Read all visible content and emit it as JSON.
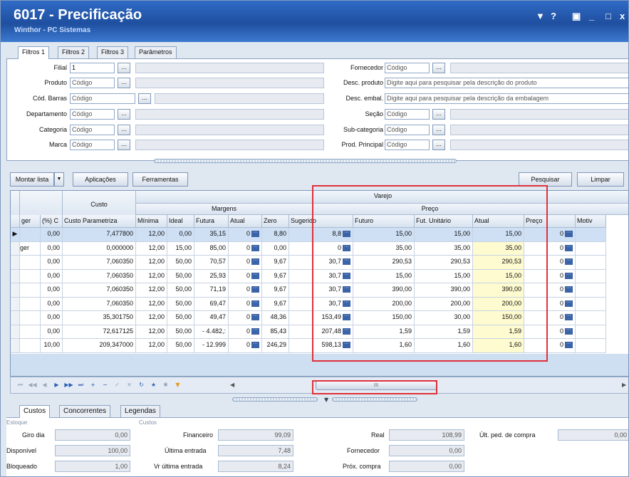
{
  "window": {
    "title": "6017 - Precificação",
    "subtitle": "Winthor - PC Sistemas",
    "controls": [
      "▼",
      "?",
      "▣",
      "_",
      "□",
      "x"
    ]
  },
  "top_tabs": [
    "Filtros 1",
    "Filtros 2",
    "Filtros 3",
    "Parâmetros"
  ],
  "filters": {
    "filial": {
      "label": "Filial",
      "value": "1"
    },
    "produto": {
      "label": "Produto",
      "placeholder": "Código"
    },
    "cod_barras": {
      "label": "Cód. Barras",
      "placeholder": "Código"
    },
    "departamento": {
      "label": "Departamento",
      "placeholder": "Código"
    },
    "categoria": {
      "label": "Categoria",
      "placeholder": "Código"
    },
    "marca": {
      "label": "Marca",
      "placeholder": "Código"
    },
    "fornecedor": {
      "label": "Fornecedor",
      "placeholder": "Código"
    },
    "desc_produto": {
      "label": "Desc. produto",
      "placeholder": "Digite aqui para pesquisar pela descrição do produto"
    },
    "desc_embal": {
      "label": "Desc. embal.",
      "placeholder": "Digite aqui para pesquisar pela descrição da embalagem"
    },
    "secao": {
      "label": "Seção",
      "placeholder": "Código"
    },
    "subcategoria": {
      "label": "Sub-categoria",
      "placeholder": "Código"
    },
    "prod_principal": {
      "label": "Prod. Principal",
      "placeholder": "Código"
    },
    "lookup_label": "..."
  },
  "toolbar": {
    "montar_lista": "Montar lista",
    "aplicacoes": "Aplicações",
    "ferramentas": "Ferramentas",
    "pesquisar": "Pesquisar",
    "limpar": "Limpar"
  },
  "grid": {
    "group_varejo": "Varejo",
    "group_custo": "Custo",
    "group_margens": "Margens",
    "group_preco": "Preço",
    "columns": [
      "ger",
      "(%) C",
      "Custo Parametriza",
      "Mínima",
      "Ideal",
      "Futura",
      "Atual",
      "Zero",
      "Sugerido",
      "Futuro",
      "Fut. Unitário",
      "Atual",
      "Preço",
      "Motiv"
    ],
    "rows": [
      [
        "",
        "0,00",
        "7,477800",
        "12,00",
        "0,00",
        "35,15",
        "0",
        "8,80",
        "8,8",
        "15,00",
        "15,00",
        "15,00",
        "0",
        ""
      ],
      [
        "ger",
        "0,00",
        "0,000000",
        "12,00",
        "15,00",
        "85,00",
        "0",
        "0,00",
        "0",
        "35,00",
        "35,00",
        "35,00",
        "0",
        ""
      ],
      [
        "",
        "0,00",
        "7,060350",
        "12,00",
        "50,00",
        "70,57",
        "0",
        "9,67",
        "30,7",
        "290,53",
        "290,53",
        "290,53",
        "0",
        ""
      ],
      [
        "",
        "0,00",
        "7,060350",
        "12,00",
        "50,00",
        "25,93",
        "0",
        "9,67",
        "30,7",
        "15,00",
        "15,00",
        "15,00",
        "0",
        ""
      ],
      [
        "",
        "0,00",
        "7,060350",
        "12,00",
        "50,00",
        "71,19",
        "0",
        "9,67",
        "30,7",
        "390,00",
        "390,00",
        "390,00",
        "0",
        ""
      ],
      [
        "",
        "0,00",
        "7,060350",
        "12,00",
        "50,00",
        "69,47",
        "0",
        "9,67",
        "30,7",
        "200,00",
        "200,00",
        "200,00",
        "0",
        ""
      ],
      [
        "",
        "0,00",
        "35,301750",
        "12,00",
        "50,00",
        "49,47",
        "0",
        "48,36",
        "153,49",
        "150,00",
        "30,00",
        "150,00",
        "0",
        ""
      ],
      [
        "",
        "0,00",
        "72,617125",
        "12,00",
        "50,00",
        "- 4.482,:",
        "0",
        "85,43",
        "207,48",
        "1,59",
        "1,59",
        "1,59",
        "0",
        ""
      ],
      [
        "",
        "10,00",
        "209,347000",
        "12,00",
        "50,00",
        "- 12.999",
        "0",
        "246,29",
        "598,13",
        "1,60",
        "1,60",
        "1,60",
        "0",
        ""
      ]
    ],
    "ellipsis": "···",
    "current_row_marker": "▶"
  },
  "navbar": {
    "buttons": [
      "⏮",
      "◀◀",
      "◀",
      "▶",
      "▶▶",
      "⏭",
      "+",
      "−",
      "✓",
      "✕",
      "↻",
      "★",
      "✱",
      "▼"
    ],
    "scroll_thumb": "III"
  },
  "bottom_tabs": [
    "Custos",
    "Concorrentes",
    "Legendas"
  ],
  "bottom": {
    "legend_estoque": "Estoque",
    "legend_custos": "Custos",
    "giro_dia": {
      "label": "Giro dia",
      "value": "0,00"
    },
    "disponivel": {
      "label": "Disponível",
      "value": "100,00"
    },
    "bloqueado": {
      "label": "Bloqueado",
      "value": "1,00"
    },
    "financeiro": {
      "label": "Financeiro",
      "value": "99,09"
    },
    "ultima_entrada": {
      "label": "Última entrada",
      "value": "7,48"
    },
    "vr_ultima_entrada": {
      "label": "Vr última entrada",
      "value": "8,24"
    },
    "real": {
      "label": "Real",
      "value": "108,99"
    },
    "fornecedor": {
      "label": "Fornecedor",
      "value": "0,00"
    },
    "prox_compra": {
      "label": "Próx. compra",
      "value": "0,00"
    },
    "ult_ped_compra": {
      "label": "Últ. ped. de compra",
      "value": "0,00"
    }
  },
  "colors": {
    "title_bg": "#1f4f9f",
    "highlight_red": "#e0303a",
    "atual_cell_bg": "#fffbd0",
    "selected_row": "#cfe0f5"
  }
}
